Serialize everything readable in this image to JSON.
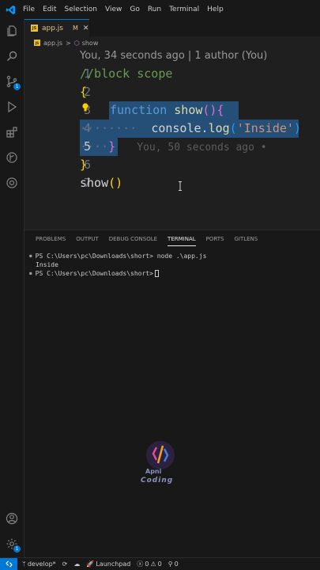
{
  "menu": [
    "File",
    "Edit",
    "Selection",
    "View",
    "Go",
    "Run",
    "Terminal",
    "Help"
  ],
  "tab": {
    "filename": "app.js",
    "badge": "JS",
    "modified": "M",
    "close": "✕"
  },
  "breadcrumb": {
    "file": "app.js",
    "separator": ">",
    "symbol": "show"
  },
  "codelens": "You, 34 seconds ago | 1 author (You)",
  "activity": {
    "scm_badge": "1",
    "settings_badge": "1"
  },
  "code": {
    "line_numbers": [
      "1",
      "2",
      "3",
      "4",
      "5",
      "6",
      "7"
    ],
    "l1": "//block scope",
    "l2": "{",
    "l3_kw": "function",
    "l3_fn": "show",
    "l3_p": "()",
    "l3_b": "{",
    "l4_dots": "········",
    "l4_obj": "console",
    "l4_dot": ".",
    "l4_fn": "log",
    "l4_open": "(",
    "l4_str": "'Inside'",
    "l4_close": ")",
    "l5_dots": "····",
    "l5_b": "}",
    "l5_blame": "You, 50 seconds ago •",
    "l3_dots": "····",
    "l6": "}",
    "l7_fn": "show",
    "l7_p": "()"
  },
  "panel": {
    "tabs": [
      "PROBLEMS",
      "OUTPUT",
      "DEBUG CONSOLE",
      "TERMINAL",
      "PORTS",
      "GITLENS"
    ],
    "active_tab": "TERMINAL",
    "terminal": {
      "line1_prompt": "PS C:\\Users\\pc\\Downloads\\short>",
      "line1_cmd": "node .\\app.js",
      "line2": "Inside",
      "line3_prompt": "PS C:\\Users\\pc\\Downloads\\short>"
    }
  },
  "watermark": {
    "line1": "Apni",
    "line2": "Coding"
  },
  "status": {
    "branch": "develop*",
    "launchpad": "Launchpad",
    "errors": "0",
    "warnings": "0",
    "ports": "0"
  },
  "colors": {
    "accent": "#0078d4",
    "selection": "#264f78",
    "js_badge": "#e8c12c"
  }
}
